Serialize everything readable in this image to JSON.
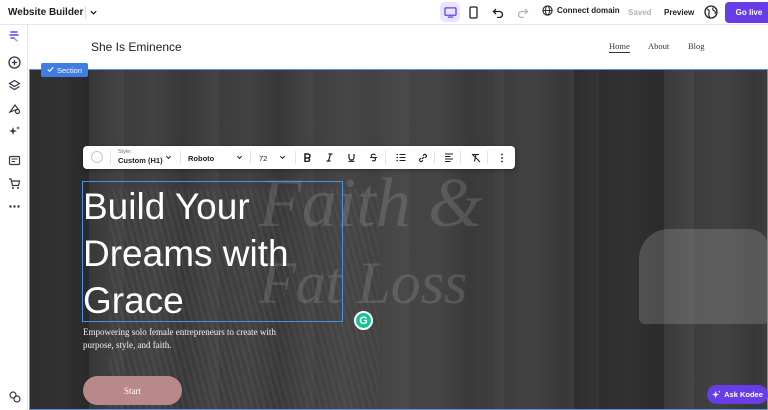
{
  "topbar": {
    "app_name": "Website Builder",
    "connect_domain": "Connect domain",
    "saved": "Saved",
    "preview": "Preview",
    "go_live": "Go live",
    "accent_color": "#673de6"
  },
  "sidebar": {
    "icons": [
      "hostinger-logo-icon",
      "add-icon",
      "layers-icon",
      "palette-icon",
      "ai-sparkles-icon",
      "blog-icon",
      "store-cart-icon",
      "more-icon",
      "settings-icon"
    ]
  },
  "site": {
    "title": "She Is Eminence",
    "nav": [
      "Home",
      "About",
      "Blog"
    ]
  },
  "section_tag": "Section",
  "toolbar": {
    "style_label": "Style:",
    "style_value": "Custom (H1)",
    "font": "Roboto",
    "size": "72"
  },
  "hero": {
    "bg_text_1": "Faith &",
    "bg_text_2": "Fat Loss",
    "heading": "Build Your Dreams with Grace",
    "subtitle": "Empowering solo female entrepreneurs to create with purpose, style, and faith.",
    "cta": "Start",
    "cta_color": "#b88988"
  },
  "assistant": {
    "label": "Ask Kodee"
  }
}
